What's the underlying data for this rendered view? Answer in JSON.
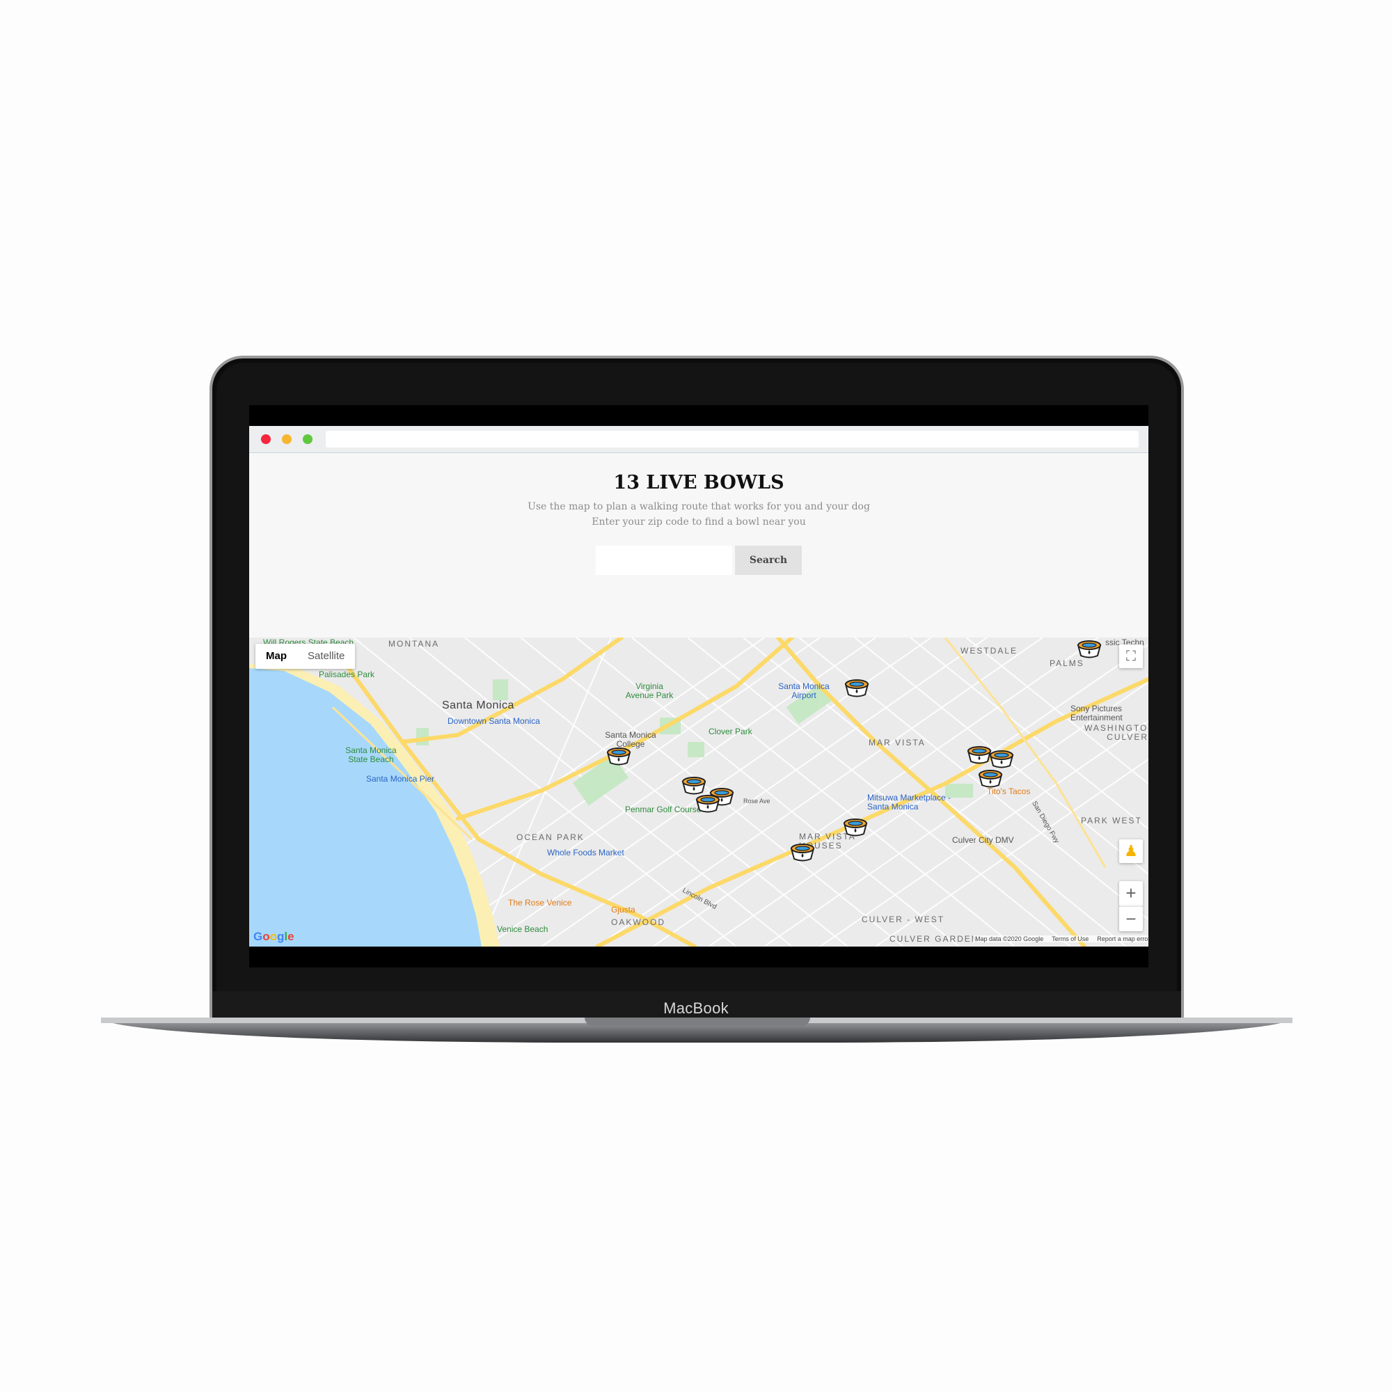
{
  "device": {
    "brand": "MacBook"
  },
  "page": {
    "title": "13 LIVE BOWLS",
    "subtitle_line1": "Use the map to plan a walking route that works for you and your dog",
    "subtitle_line2": "Enter your zip code to find a bowl near you",
    "search": {
      "placeholder": "",
      "button_label": "Search"
    }
  },
  "browser": {
    "dots": {
      "close": "#f6263d",
      "minimize": "#f8b52f",
      "zoom": "#5fc83d"
    }
  },
  "map": {
    "type_controls": {
      "map_label": "Map",
      "satellite_label": "Satellite"
    },
    "icons": {
      "fullscreen": "fullscreen-icon",
      "pegman": "pegman-icon",
      "zoom_in": "+",
      "zoom_out": "−"
    },
    "logo": "Google",
    "attribution": {
      "data": "Map data ©2020 Google",
      "terms": "Terms of Use",
      "report": "Report a map error"
    },
    "labels": {
      "will_rogers": "Will Rogers State Beach",
      "montana": "MONTANA",
      "westdale": "WESTDALE",
      "palms": "PALMS",
      "classic": "ssic Techn",
      "palisades_park": "Palisades Park",
      "virginia_park": "Virginia Avenue Park",
      "santa_monica_airport": "Santa Monica Airport",
      "santa_monica": "Santa Monica",
      "downtown_sm": "Downtown Santa Monica",
      "sony": "Sony Pictures Entertainment",
      "washington_culver": "WASHINGTON CULVER",
      "smc": "Santa Monica College",
      "clover_park": "Clover Park",
      "mar_vista": "MAR VISTA",
      "sm_state_beach": "Santa Monica State Beach",
      "sm_pier": "Santa Monica Pier",
      "titos": "Tito's Tacos",
      "mitsuwa": "Mitsuwa Marketplace - Santa Monica",
      "penmar": "Penmar Golf Course",
      "park_west": "PARK WEST",
      "ocean_park": "OCEAN PARK",
      "mar_vista_houses": "MAR VISTA HOUSES",
      "culver_dmv": "Culver City DMV",
      "whole_foods": "Whole Foods Market",
      "rose_venice": "The Rose Venice",
      "gjusta": "Gjusta",
      "oakwood": "OAKWOOD",
      "culver_west": "CULVER - WEST",
      "venice_beach": "Venice Beach",
      "culver_garden": "CULVER GARDEN",
      "lincoln_blvd": "Lincoln Blvd",
      "san_diego_fwy": "San Diego Fwy",
      "rose_ave": "Rose Ave"
    },
    "colors": {
      "water": "#a7d8fb",
      "land": "#ebebeb",
      "park": "#c6e8c5",
      "highway": "#fcd968",
      "road": "#ffffff",
      "sand": "#fbefb3"
    },
    "bowl_icon": "dog-bowl-icon"
  }
}
